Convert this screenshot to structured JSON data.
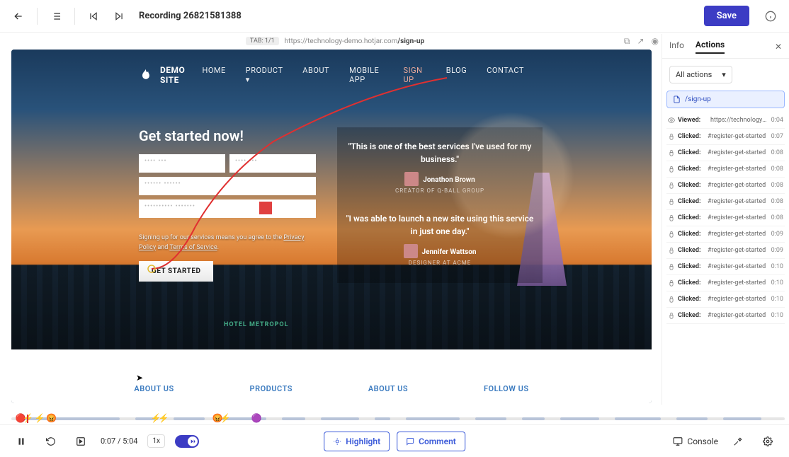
{
  "header": {
    "title": "Recording 26821581388",
    "save": "Save",
    "tab_indicator": "TAB: 1/1",
    "url_prefix": "https://technology-demo.hotjar.com",
    "url_path": "/sign-up"
  },
  "site": {
    "brand": "DEMO SITE",
    "nav": [
      "HOME",
      "PRODUCT ▾",
      "ABOUT",
      "MOBILE APP",
      "SIGN UP",
      "BLOG",
      "CONTACT"
    ],
    "active_nav_index": 4,
    "hotel_sign": "HOTEL METROPOL"
  },
  "signup": {
    "heading": "Get started now!",
    "legal_prefix": "Signing up for our services means you agree to the ",
    "privacy": "Privacy Policy",
    "and": " and ",
    "tos": "Terms of Service",
    "cta": "GET STARTED"
  },
  "testimonials": [
    {
      "quote": "\"This is one of the best services I've used for my business.\"",
      "name": "Jonathon Brown",
      "role": "CREATOR OF Q-BALL GROUP"
    },
    {
      "quote": "\"I was able to launch a new site using this service in just one day.\"",
      "name": "Jennifer Wattson",
      "role": "DESIGNER AT ACME"
    }
  ],
  "footer_links": [
    "ABOUT US",
    "PRODUCTS",
    "ABOUT US",
    "FOLLOW US"
  ],
  "panel": {
    "tabs": [
      "Info",
      "Actions"
    ],
    "active_tab": 1,
    "filter": "All actions",
    "page_chip": "/sign-up",
    "events": [
      {
        "type": "Viewed:",
        "target": "https://technology-demo.ho…",
        "ts": "0:04"
      },
      {
        "type": "Clicked:",
        "target": "#register-get-started",
        "ts": "0:07"
      },
      {
        "type": "Clicked:",
        "target": "#register-get-started",
        "ts": "0:08"
      },
      {
        "type": "Clicked:",
        "target": "#register-get-started",
        "ts": "0:08"
      },
      {
        "type": "Clicked:",
        "target": "#register-get-started",
        "ts": "0:08"
      },
      {
        "type": "Clicked:",
        "target": "#register-get-started",
        "ts": "0:08"
      },
      {
        "type": "Clicked:",
        "target": "#register-get-started",
        "ts": "0:08"
      },
      {
        "type": "Clicked:",
        "target": "#register-get-started",
        "ts": "0:09"
      },
      {
        "type": "Clicked:",
        "target": "#register-get-started",
        "ts": "0:09"
      },
      {
        "type": "Clicked:",
        "target": "#register-get-started",
        "ts": "0:10"
      },
      {
        "type": "Clicked:",
        "target": "#register-get-started",
        "ts": "0:10"
      },
      {
        "type": "Clicked:",
        "target": "#register-get-started",
        "ts": "0:10"
      },
      {
        "type": "Clicked:",
        "target": "#register-get-started",
        "ts": "0:10"
      }
    ]
  },
  "playback": {
    "current": "0:07",
    "total": "5:04",
    "speed": "1x",
    "highlight": "Highlight",
    "comment": "Comment",
    "console": "Console"
  },
  "timeline": {
    "segments": [
      {
        "l": 1,
        "w": 8
      },
      {
        "l": 8,
        "w": 6
      },
      {
        "l": 16,
        "w": 3
      },
      {
        "l": 21,
        "w": 4
      },
      {
        "l": 27,
        "w": 6
      },
      {
        "l": 35,
        "w": 3
      },
      {
        "l": 40,
        "w": 5
      },
      {
        "l": 47,
        "w": 2
      },
      {
        "l": 51,
        "w": 7
      },
      {
        "l": 60,
        "w": 4
      },
      {
        "l": 66,
        "w": 3
      },
      {
        "l": 71,
        "w": 5
      },
      {
        "l": 78,
        "w": 6
      },
      {
        "l": 86,
        "w": 4
      },
      {
        "l": 92,
        "w": 5
      }
    ],
    "markers": [
      {
        "l": 0.5,
        "e": "🔴"
      },
      {
        "l": 1.5,
        "e": "⚡"
      },
      {
        "l": 3,
        "e": "⚡"
      },
      {
        "l": 4.5,
        "e": "😡"
      },
      {
        "l": 18,
        "e": "⚡"
      },
      {
        "l": 19,
        "e": "⚡"
      },
      {
        "l": 26,
        "e": "😡"
      },
      {
        "l": 27,
        "e": "⚡"
      },
      {
        "l": 31,
        "e": "🟣"
      }
    ]
  }
}
